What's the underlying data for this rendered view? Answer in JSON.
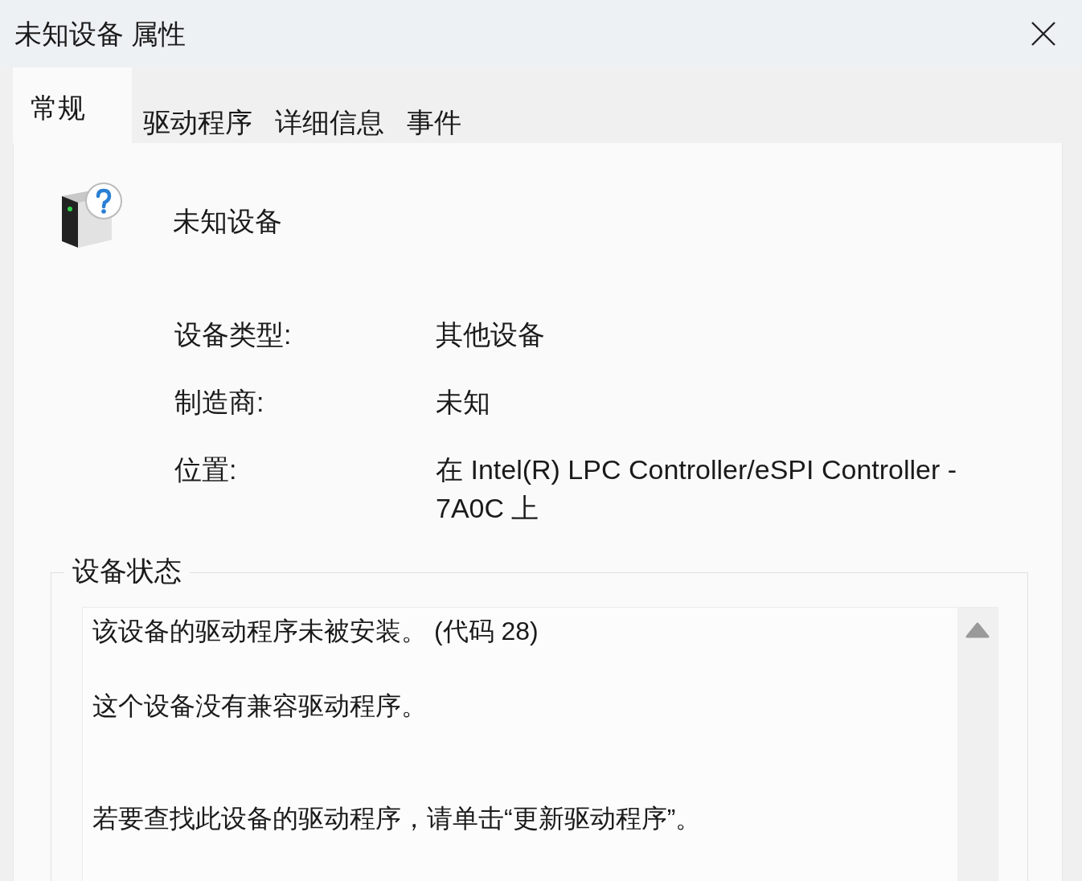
{
  "window": {
    "title": "未知设备 属性"
  },
  "tabs": [
    {
      "label": "常规",
      "selected": true
    },
    {
      "label": "驱动程序",
      "selected": false
    },
    {
      "label": "详细信息",
      "selected": false
    },
    {
      "label": "事件",
      "selected": false
    }
  ],
  "device": {
    "name": "未知设备"
  },
  "properties": [
    {
      "label": "设备类型:",
      "value": "其他设备"
    },
    {
      "label": "制造商:",
      "value": "未知"
    },
    {
      "label": "位置:",
      "value": "在 Intel(R) LPC Controller/eSPI Controller - 7A0C 上"
    }
  ],
  "status": {
    "legend": "设备状态",
    "paragraphs": [
      "该设备的驱动程序未被安装。 (代码 28)",
      "这个设备没有兼容驱动程序。",
      "若要查找此设备的驱动程序，请单击“更新驱动程序”。"
    ]
  }
}
